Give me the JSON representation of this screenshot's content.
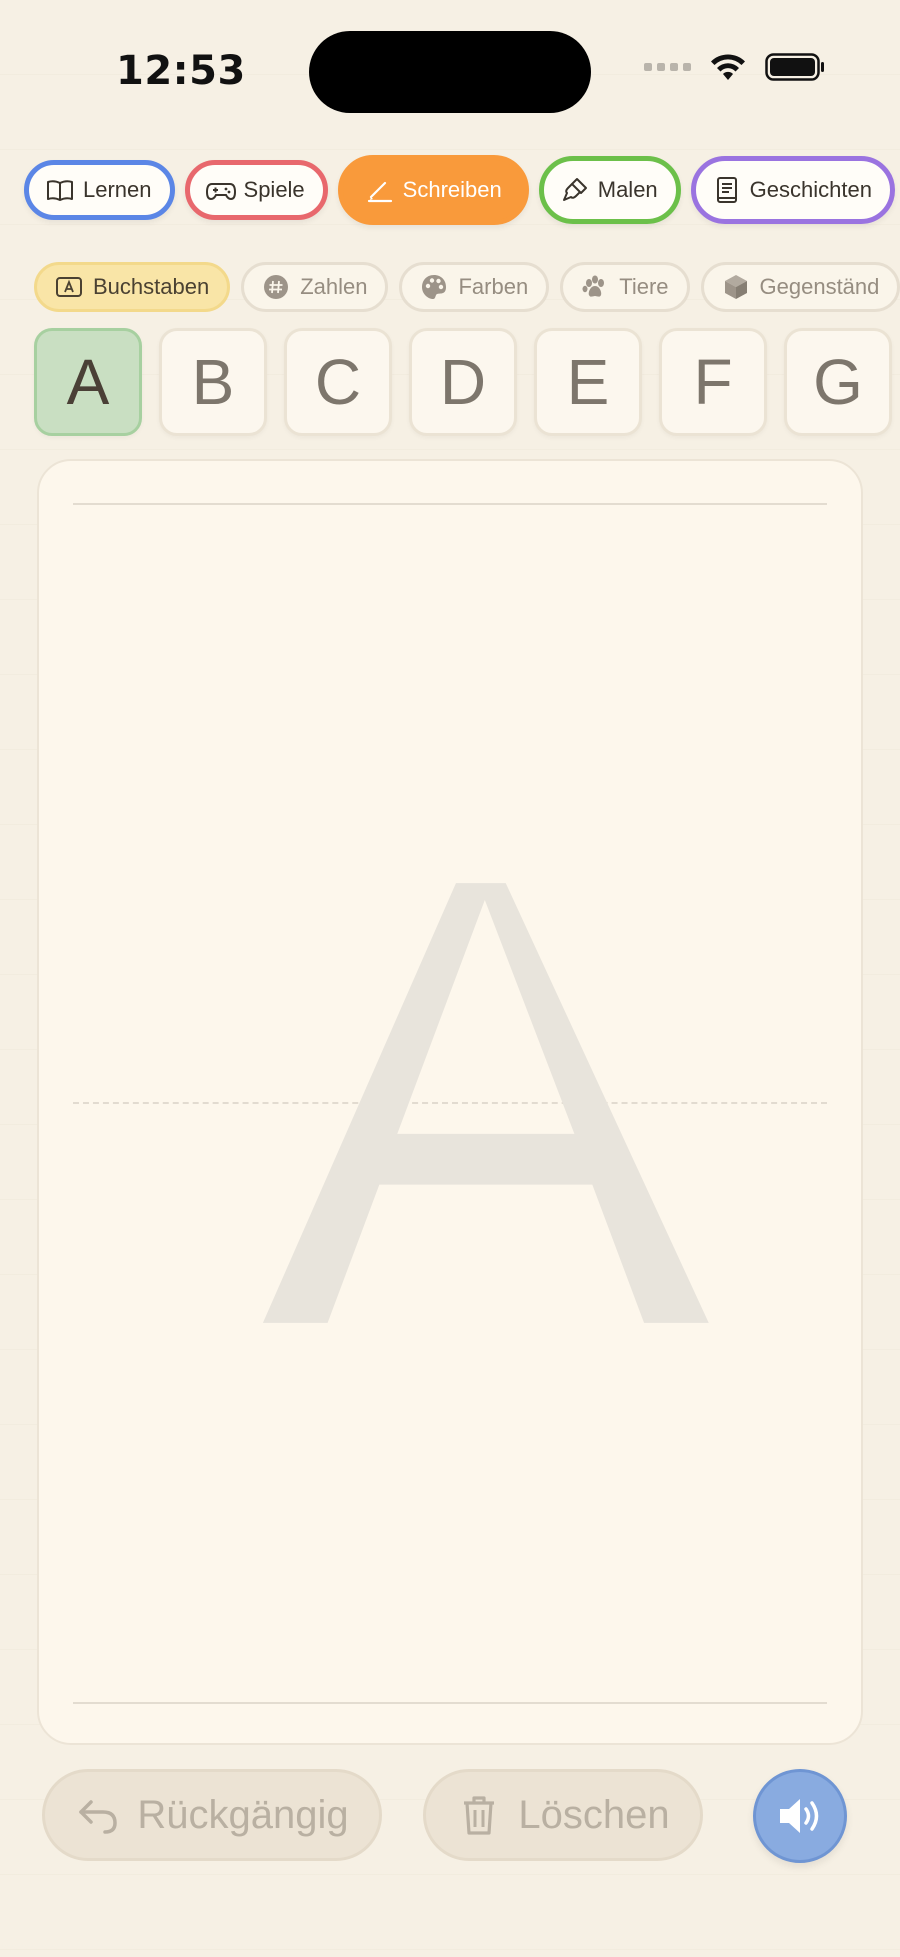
{
  "status_bar": {
    "time": "12:53"
  },
  "modes": [
    {
      "label": "Lernen",
      "icon": "book-icon",
      "color": "#5b86e6"
    },
    {
      "label": "Spiele",
      "icon": "gamepad-icon",
      "color": "#e8686d"
    },
    {
      "label": "Schreiben",
      "icon": "pencil-icon",
      "color": "#f99a3b",
      "active": true
    },
    {
      "label": "Malen",
      "icon": "brush-icon",
      "color": "#6cc04a"
    },
    {
      "label": "Geschichten",
      "icon": "storybook-icon",
      "color": "#9a73e0"
    }
  ],
  "categories": [
    {
      "label": "Buchstaben",
      "icon": "letter-a-icon",
      "active": true
    },
    {
      "label": "Zahlen",
      "icon": "hash-icon"
    },
    {
      "label": "Farben",
      "icon": "palette-icon"
    },
    {
      "label": "Tiere",
      "icon": "paw-icon"
    },
    {
      "label": "Gegenständ",
      "icon": "cube-icon"
    }
  ],
  "letters": [
    "A",
    "B",
    "C",
    "D",
    "E",
    "F",
    "G"
  ],
  "selected_letter": "A",
  "canvas": {
    "guide_letter": "A"
  },
  "actions": {
    "undo_label": "Rückgängig",
    "clear_label": "Löschen"
  }
}
